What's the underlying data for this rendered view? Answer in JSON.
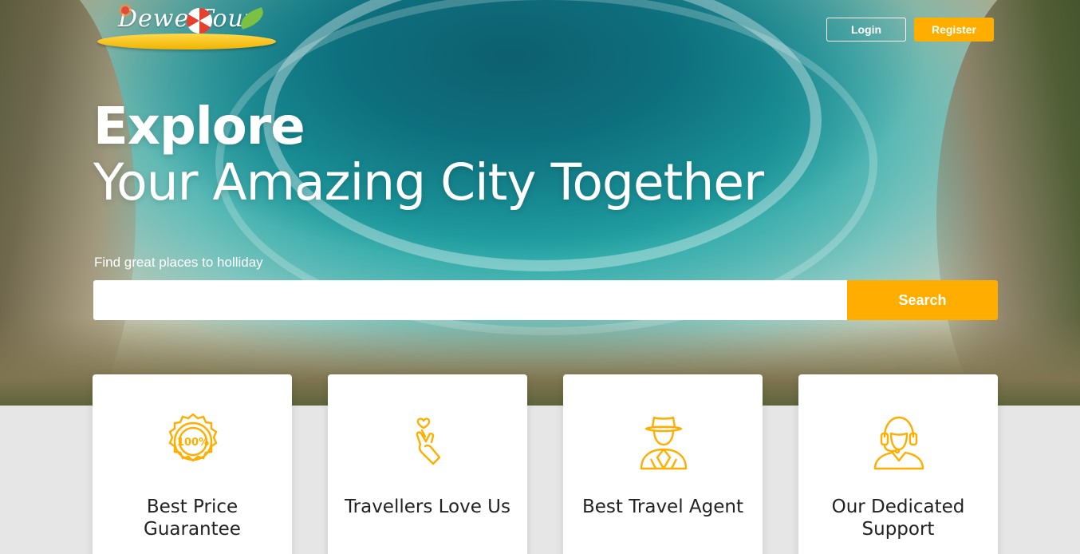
{
  "logo": {
    "text": "Dewe Tour"
  },
  "header": {
    "login_label": "Login",
    "register_label": "Register"
  },
  "hero": {
    "title": "Explore",
    "subtitle": "Your Amazing City Together",
    "search_label": "Find great places to holliday",
    "search_placeholder": "",
    "search_button": "Search"
  },
  "colors": {
    "accent": "#ffae00",
    "icon": "#ffae00",
    "background": "#e6e6e6"
  },
  "features": [
    {
      "icon": "guarantee-badge-icon",
      "title": "Best Price Guarantee"
    },
    {
      "icon": "finger-heart-icon",
      "title": "Travellers Love Us"
    },
    {
      "icon": "travel-agent-icon",
      "title": "Best Travel Agent"
    },
    {
      "icon": "support-agent-icon",
      "title": "Our Dedicated Support"
    }
  ]
}
